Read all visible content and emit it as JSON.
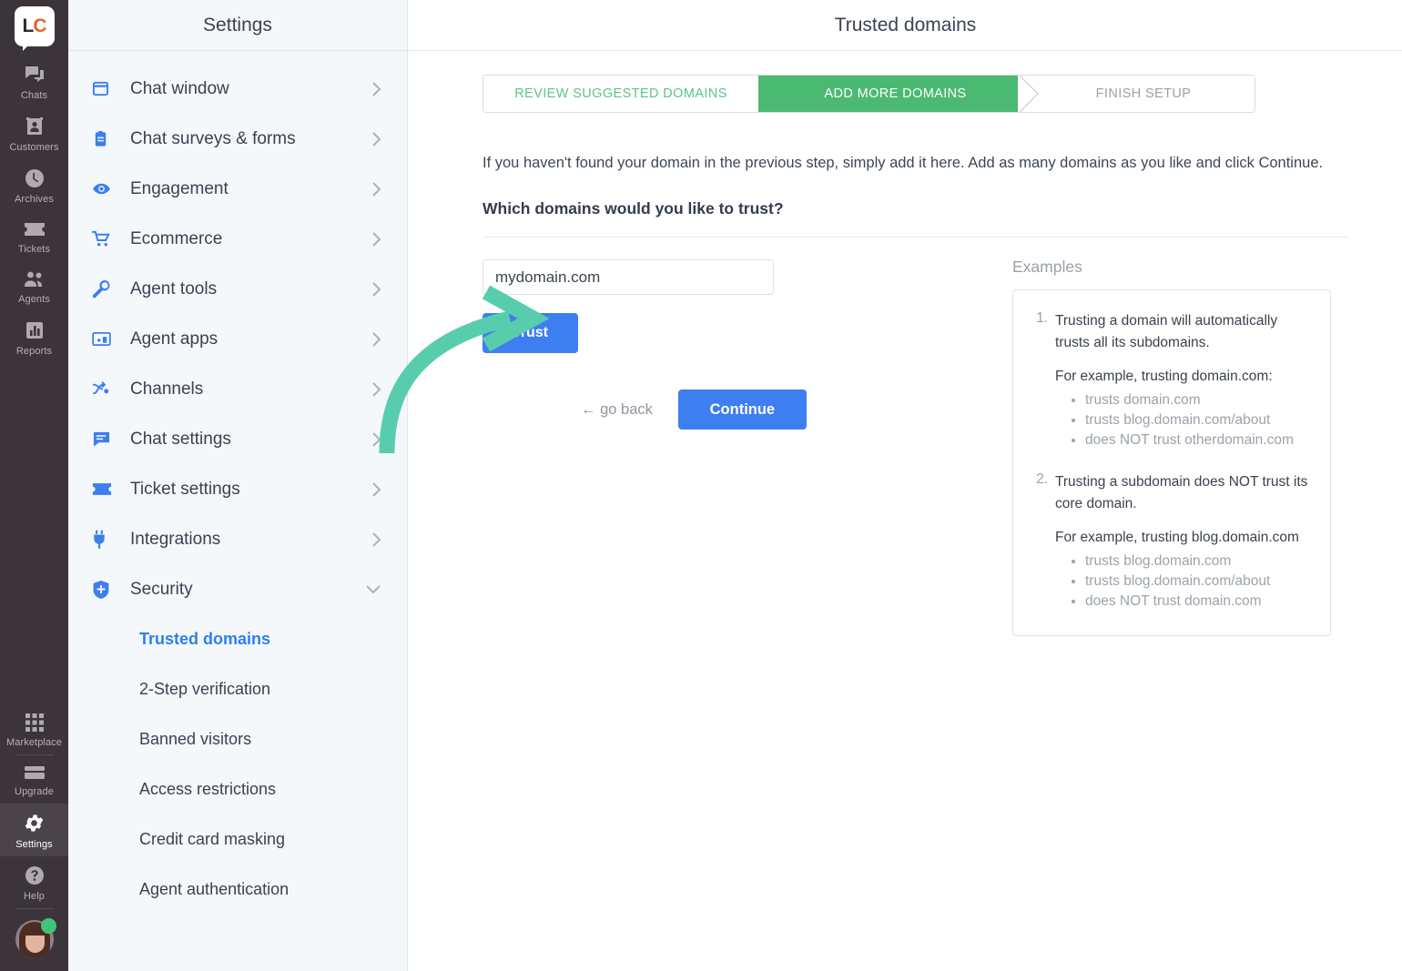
{
  "rail": {
    "logo": {
      "part1": "LC",
      "name": "livechat-logo"
    },
    "items": [
      {
        "label": "Chats",
        "icon": "chats-icon",
        "active": false
      },
      {
        "label": "Customers",
        "icon": "customers-icon",
        "active": false
      },
      {
        "label": "Archives",
        "icon": "archives-icon",
        "active": false
      },
      {
        "label": "Tickets",
        "icon": "tickets-icon",
        "active": false
      },
      {
        "label": "Agents",
        "icon": "agents-icon",
        "active": false
      },
      {
        "label": "Reports",
        "icon": "reports-icon",
        "active": false
      }
    ],
    "bottom_items": [
      {
        "label": "Marketplace",
        "icon": "marketplace-icon",
        "active": false
      },
      {
        "label": "Upgrade",
        "icon": "upgrade-icon",
        "active": false
      },
      {
        "label": "Settings",
        "icon": "gear-icon",
        "active": true
      },
      {
        "label": "Help",
        "icon": "help-icon",
        "active": false
      }
    ],
    "avatar_status": "online"
  },
  "settings": {
    "header_title": "Settings",
    "items": [
      {
        "label": "Chat window",
        "icon": "window-icon",
        "chevron": "chevron-right-icon"
      },
      {
        "label": "Chat surveys & forms",
        "icon": "clipboard-icon",
        "chevron": "chevron-right-icon"
      },
      {
        "label": "Engagement",
        "icon": "eye-icon",
        "chevron": "chevron-right-icon"
      },
      {
        "label": "Ecommerce",
        "icon": "cart-icon",
        "chevron": "chevron-right-icon"
      },
      {
        "label": "Agent tools",
        "icon": "wrench-icon",
        "chevron": "chevron-right-icon"
      },
      {
        "label": "Agent apps",
        "icon": "apps-icon",
        "chevron": "chevron-right-icon"
      },
      {
        "label": "Channels",
        "icon": "channels-icon",
        "chevron": "chevron-right-icon"
      },
      {
        "label": "Chat settings",
        "icon": "chat-bubble-icon",
        "chevron": "chevron-right-icon"
      },
      {
        "label": "Ticket settings",
        "icon": "ticket-icon",
        "chevron": "chevron-right-icon"
      },
      {
        "label": "Integrations",
        "icon": "plug-icon",
        "chevron": "chevron-right-icon"
      },
      {
        "label": "Security",
        "icon": "shield-icon",
        "chevron": "chevron-down-icon"
      }
    ],
    "sub_items": [
      {
        "label": "Trusted domains",
        "active": true
      },
      {
        "label": "2-Step verification",
        "active": false
      },
      {
        "label": "Banned visitors",
        "active": false
      },
      {
        "label": "Access restrictions",
        "active": false
      },
      {
        "label": "Credit card masking",
        "active": false
      },
      {
        "label": "Agent authentication",
        "active": false
      }
    ]
  },
  "main": {
    "header_title": "Trusted domains",
    "steps": [
      {
        "label": "REVIEW SUGGESTED DOMAINS",
        "state": "done"
      },
      {
        "label": "ADD MORE DOMAINS",
        "state": "current"
      },
      {
        "label": "FINISH SETUP",
        "state": "todo"
      }
    ],
    "intro": "If you haven't found your domain in the previous step, simply add it here. Add as many domains as you like and click Continue.",
    "question": "Which domains would you like to trust?",
    "domain_input_value": "mydomain.com",
    "domain_input_placeholder": "mydomain.com",
    "trust_button": "Trust",
    "go_back": "← go back",
    "continue_button": "Continue",
    "examples_title": "Examples",
    "examples": [
      {
        "num": "1.",
        "head": "Trusting a domain will automatically trusts all its subdomains.",
        "sub": "For example, trusting domain.com:",
        "bullets": [
          "trusts domain.com",
          "trusts blog.domain.com/about",
          "does NOT trust otherdomain.com"
        ]
      },
      {
        "num": "2.",
        "head": "Trusting a subdomain does NOT trust its core domain.",
        "sub": "For example, trusting blog.domain.com",
        "bullets": [
          "trusts blog.domain.com",
          "trusts blog.domain.com/about",
          "does NOT trust domain.com"
        ]
      }
    ]
  },
  "annotation": {
    "arrow_color": "#58cdad",
    "name": "callout-arrow-to-trust-button"
  },
  "colors": {
    "accent_blue": "#3d7ef0",
    "step_green": "#4cb972",
    "step_done_text": "#5cc489",
    "rail_bg": "#3b343b",
    "panel_bg": "#f4f8fa"
  }
}
